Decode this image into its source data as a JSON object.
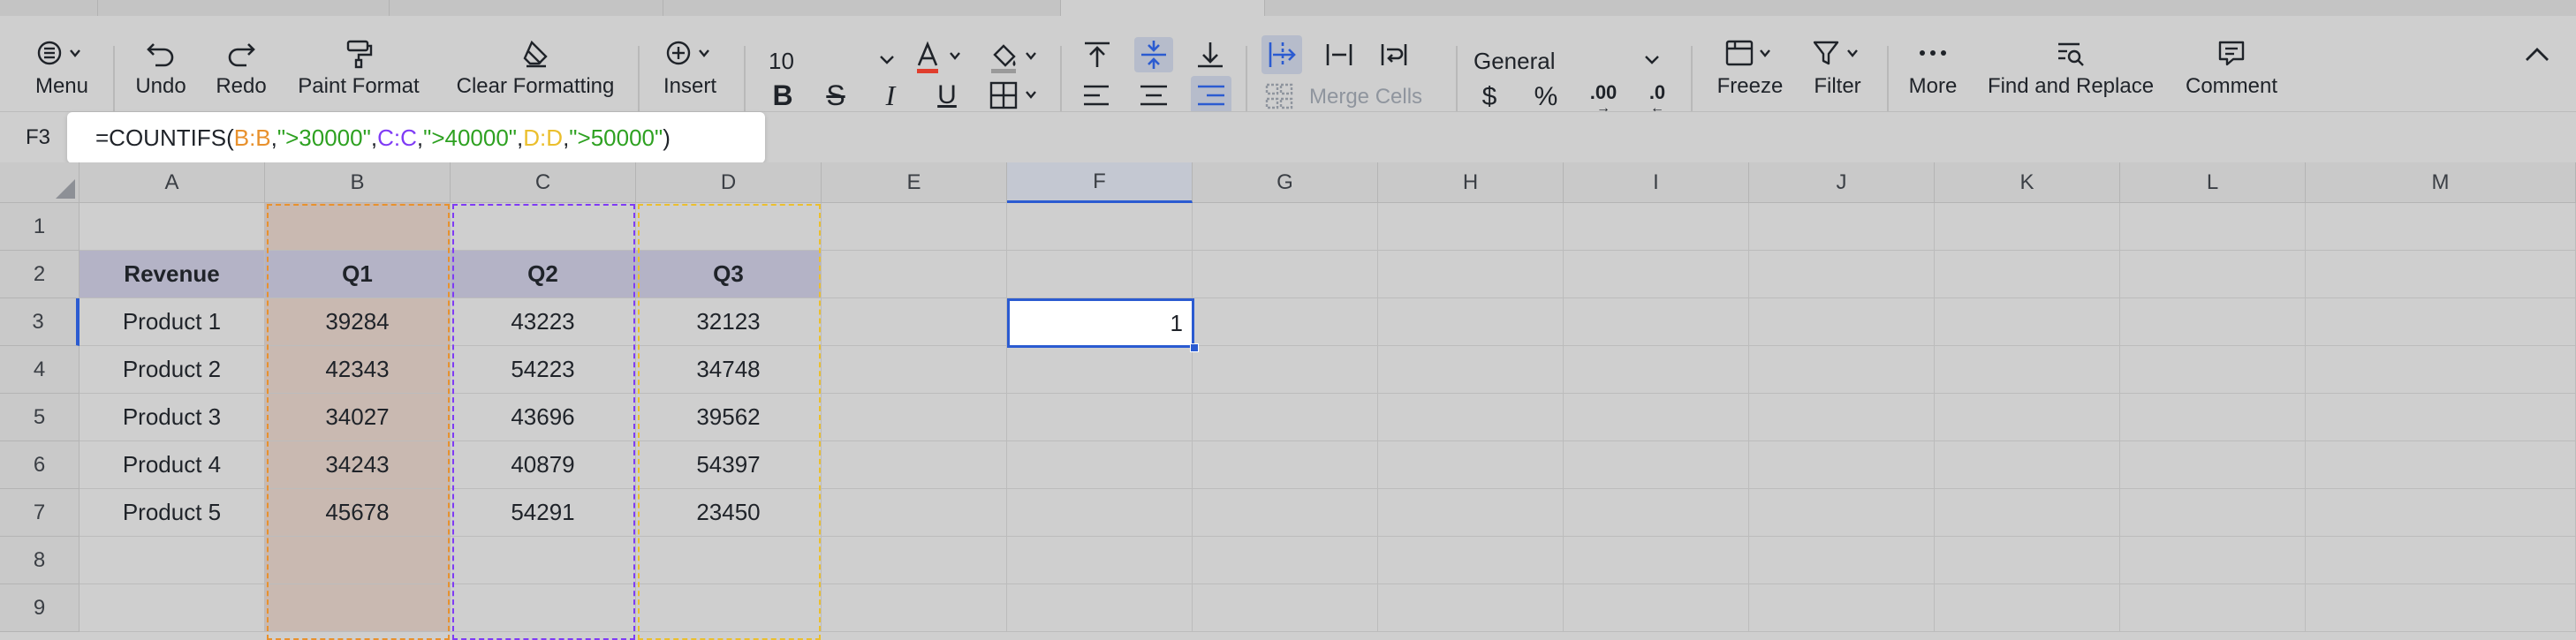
{
  "toolbar": {
    "menu_label": "Menu",
    "undo_label": "Undo",
    "redo_label": "Redo",
    "paint_format_label": "Paint Format",
    "clear_formatting_label": "Clear Formatting",
    "insert_label": "Insert",
    "font_size": "10",
    "merge_cells_label": "Merge Cells",
    "number_format": "General",
    "currency_symbol": "$",
    "percent_symbol": "%",
    "freeze_label": "Freeze",
    "filter_label": "Filter",
    "more_label": "More",
    "find_replace_label": "Find and Replace",
    "comment_label": "Comment",
    "bold_glyph": "B",
    "strike_glyph": "S",
    "italic_glyph": "I",
    "underline_glyph": "U",
    "decimal_inc": ".00",
    "decimal_dec": ".0",
    "text_color_glyph": "A",
    "text_color": "#e03e2d",
    "accent_color": "#2b5bd1"
  },
  "formula_bar": {
    "cell_ref": "F3",
    "formula_parts": [
      {
        "text": "=COUNTIFS(",
        "color": "#1f2329"
      },
      {
        "text": "B:B",
        "color": "#e8912d"
      },
      {
        "text": ",",
        "color": "#1f2329"
      },
      {
        "text": "\">30000\"",
        "color": "#2ea121"
      },
      {
        "text": ",",
        "color": "#1f2329"
      },
      {
        "text": "C:C",
        "color": "#7f3bf5"
      },
      {
        "text": ",",
        "color": "#1f2329"
      },
      {
        "text": "\">40000\"",
        "color": "#2ea121"
      },
      {
        "text": ",",
        "color": "#1f2329"
      },
      {
        "text": "D:D",
        "color": "#ebbf2d"
      },
      {
        "text": ",",
        "color": "#1f2329"
      },
      {
        "text": "\">50000\"",
        "color": "#2ea121"
      },
      {
        "text": ")",
        "color": "#1f2329"
      }
    ]
  },
  "sheet": {
    "columns": [
      "A",
      "B",
      "C",
      "D",
      "E",
      "F",
      "G",
      "H",
      "I",
      "J",
      "K",
      "L",
      "M"
    ],
    "rows": [
      "1",
      "2",
      "3",
      "4",
      "5",
      "6",
      "7",
      "8",
      "9"
    ],
    "header_row": [
      "Revenue",
      "Q1",
      "Q2",
      "Q3"
    ],
    "data_rows": [
      [
        "Product 1",
        "39284",
        "43223",
        "32123"
      ],
      [
        "Product 2",
        "42343",
        "54223",
        "34748"
      ],
      [
        "Product 3",
        "34027",
        "43696",
        "39562"
      ],
      [
        "Product 4",
        "34243",
        "40879",
        "54397"
      ],
      [
        "Product 5",
        "45678",
        "54291",
        "23450"
      ]
    ],
    "active_cell_value": "1",
    "range_colors": {
      "B": "#e8912d",
      "C": "#7f3bf5",
      "D": "#ebbf2d"
    },
    "header_fill": "#b4b3c6",
    "q1_fill": "#c9b9b1"
  }
}
